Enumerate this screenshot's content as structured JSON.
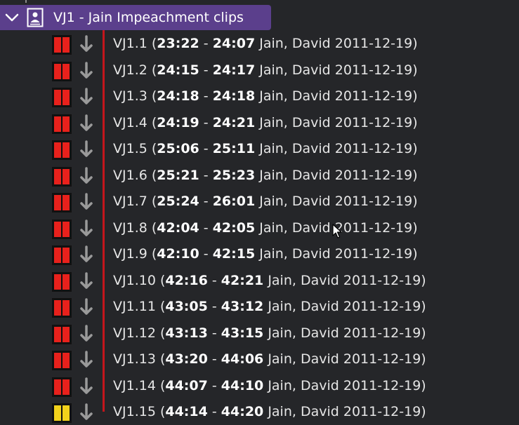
{
  "group": {
    "title": "VJ1 - Jain Impeachment clips",
    "color": "#5b3f8c"
  },
  "clip_list": {
    "accent_line_color": "#c4161c",
    "status_colors": {
      "red": "#e8211c",
      "yellow": "#f2d21b"
    },
    "clips": [
      {
        "id": "VJ1.1",
        "start": "23:22",
        "end": "24:07",
        "speaker": "Jain, David",
        "date": "2011-12-19",
        "status": "red"
      },
      {
        "id": "VJ1.2",
        "start": "24:15",
        "end": "24:17",
        "speaker": "Jain, David",
        "date": "2011-12-19",
        "status": "red"
      },
      {
        "id": "VJ1.3",
        "start": "24:18",
        "end": "24:18",
        "speaker": "Jain, David",
        "date": "2011-12-19",
        "status": "red"
      },
      {
        "id": "VJ1.4",
        "start": "24:19",
        "end": "24:21",
        "speaker": "Jain, David",
        "date": "2011-12-19",
        "status": "red"
      },
      {
        "id": "VJ1.5",
        "start": "25:06",
        "end": "25:11",
        "speaker": "Jain, David",
        "date": "2011-12-19",
        "status": "red"
      },
      {
        "id": "VJ1.6",
        "start": "25:21",
        "end": "25:23",
        "speaker": "Jain, David",
        "date": "2011-12-19",
        "status": "red"
      },
      {
        "id": "VJ1.7",
        "start": "25:24",
        "end": "26:01",
        "speaker": "Jain, David",
        "date": "2011-12-19",
        "status": "red"
      },
      {
        "id": "VJ1.8",
        "start": "42:04",
        "end": "42:05",
        "speaker": "Jain, David",
        "date": "2011-12-19",
        "status": "red"
      },
      {
        "id": "VJ1.9",
        "start": "42:10",
        "end": "42:15",
        "speaker": "Jain, David",
        "date": "2011-12-19",
        "status": "red"
      },
      {
        "id": "VJ1.10",
        "start": "42:16",
        "end": "42:21",
        "speaker": "Jain, David",
        "date": "2011-12-19",
        "status": "red"
      },
      {
        "id": "VJ1.11",
        "start": "43:05",
        "end": "43:12",
        "speaker": "Jain, David",
        "date": "2011-12-19",
        "status": "red"
      },
      {
        "id": "VJ1.12",
        "start": "43:13",
        "end": "43:15",
        "speaker": "Jain, David",
        "date": "2011-12-19",
        "status": "red"
      },
      {
        "id": "VJ1.13",
        "start": "43:20",
        "end": "44:06",
        "speaker": "Jain, David",
        "date": "2011-12-19",
        "status": "red"
      },
      {
        "id": "VJ1.14",
        "start": "44:07",
        "end": "44:10",
        "speaker": "Jain, David",
        "date": "2011-12-19",
        "status": "red"
      },
      {
        "id": "VJ1.15",
        "start": "44:14",
        "end": "44:20",
        "speaker": "Jain, David",
        "date": "2011-12-19",
        "status": "yellow"
      }
    ]
  },
  "icons": {
    "collapse": "chevron-down-icon",
    "group_type": "document-person-icon",
    "status": "pause-status-icon",
    "action": "down-arrow-icon"
  }
}
